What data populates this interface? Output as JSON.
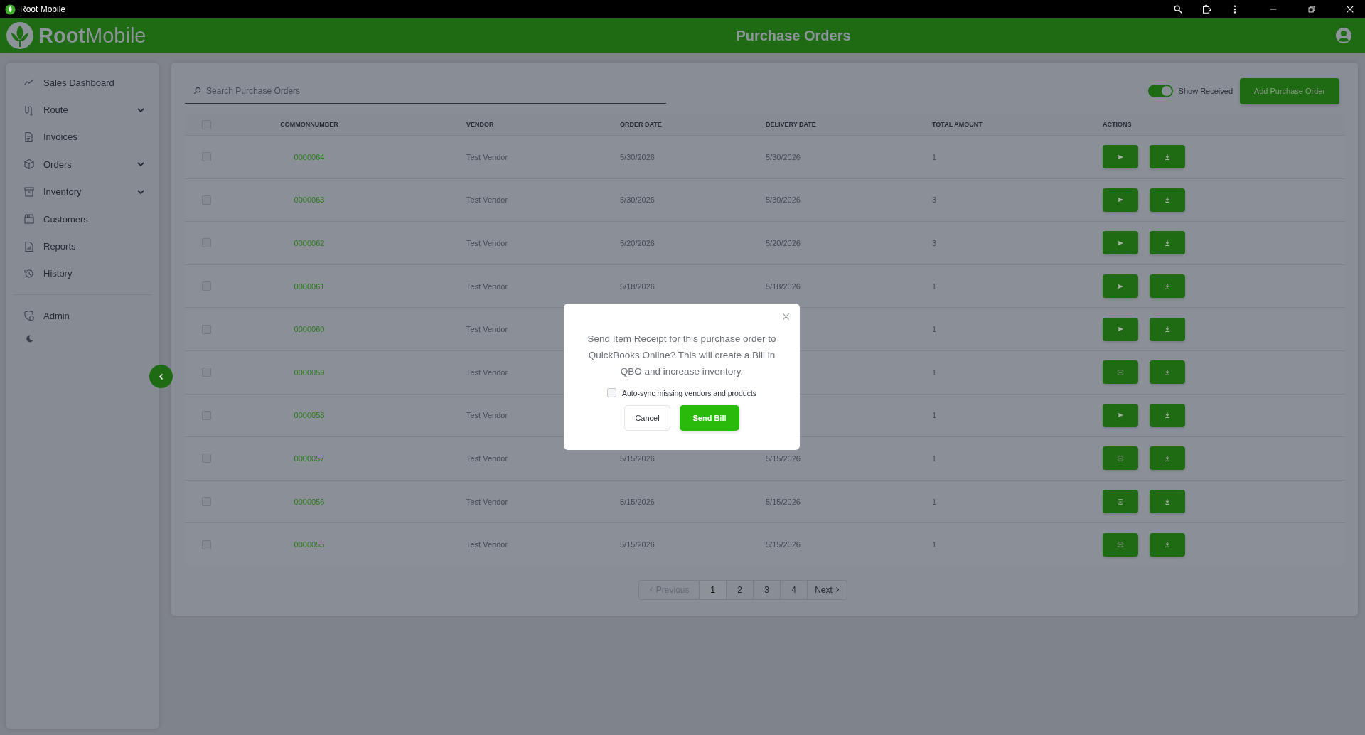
{
  "titlebar": {
    "title": "Root Mobile"
  },
  "header": {
    "brand": "**Root**Mobile",
    "title": "Purchase Orders"
  },
  "sidebar": {
    "items": [
      {
        "label": "Sales Dashboard",
        "expandable": false
      },
      {
        "label": "Route",
        "expandable": true
      },
      {
        "label": "Invoices",
        "expandable": false
      },
      {
        "label": "Orders",
        "expandable": true
      },
      {
        "label": "Inventory",
        "expandable": true
      },
      {
        "label": "Customers",
        "expandable": false
      },
      {
        "label": "Reports",
        "expandable": false
      },
      {
        "label": "History",
        "expandable": false
      }
    ],
    "admin": {
      "label": "Admin"
    }
  },
  "toolbar": {
    "search": {
      "placeholder": "Search Purchase Orders"
    },
    "toggle": {
      "label": "Show Received",
      "on": true
    },
    "add_button": "Add Purchase Order"
  },
  "table": {
    "header_checked": false,
    "columns": [
      "COMMONNUMBER",
      "VENDOR",
      "ORDER DATE",
      "DELIVERY DATE",
      "TOTAL AMOUNT",
      "ACTIONS"
    ],
    "rows": [
      {
        "checked": false,
        "number": "0000064",
        "vendor": "Test Vendor",
        "order_date": "5/30/2026",
        "delivery_date": "5/30/2026",
        "total": "1",
        "kind": "send"
      },
      {
        "checked": false,
        "number": "0000063",
        "vendor": "Test Vendor",
        "order_date": "5/30/2026",
        "delivery_date": "5/30/2026",
        "total": "3",
        "kind": "send"
      },
      {
        "checked": false,
        "number": "0000062",
        "vendor": "Test Vendor",
        "order_date": "5/20/2026",
        "delivery_date": "5/20/2026",
        "total": "3",
        "kind": "send"
      },
      {
        "checked": false,
        "number": "0000061",
        "vendor": "Test Vendor",
        "order_date": "5/18/2026",
        "delivery_date": "5/18/2026",
        "total": "1",
        "kind": "send"
      },
      {
        "checked": false,
        "number": "0000060",
        "vendor": "Test Vendor",
        "total": "1",
        "kind": "send"
      },
      {
        "checked": false,
        "number": "0000059",
        "vendor": "Test Vendor",
        "total": "1",
        "kind": "receipt"
      },
      {
        "checked": false,
        "number": "0000058",
        "vendor": "Test Vendor",
        "total": "1",
        "kind": "send"
      },
      {
        "checked": false,
        "number": "0000057",
        "vendor": "Test Vendor",
        "order_date": "5/15/2026",
        "delivery_date": "5/15/2026",
        "total": "1",
        "kind": "receipt"
      },
      {
        "checked": false,
        "number": "0000056",
        "vendor": "Test Vendor",
        "order_date": "5/15/2026",
        "delivery_date": "5/15/2026",
        "total": "1",
        "kind": "receipt"
      },
      {
        "checked": false,
        "number": "0000055",
        "vendor": "Test Vendor",
        "order_date": "5/15/2026",
        "delivery_date": "5/15/2026",
        "total": "1",
        "kind": "receipt"
      }
    ]
  },
  "pagination": {
    "previous": {
      "label": "Previous",
      "disabled": true
    },
    "pages": [
      {
        "label": "1",
        "selected": true
      },
      {
        "label": "2",
        "selected": false
      },
      {
        "label": "3",
        "selected": false
      },
      {
        "label": "4",
        "selected": false
      }
    ],
    "next": {
      "label": "Next",
      "disabled": false
    }
  },
  "dialog": {
    "message": "Send Item Receipt for this purchase order to QuickBooks Online? This will create a Bill in QBO and increase inventory.",
    "checkbox": {
      "label": "Auto-sync missing vendors and products",
      "checked": false
    },
    "cancel": "Cancel",
    "confirm": "Send Bill"
  }
}
